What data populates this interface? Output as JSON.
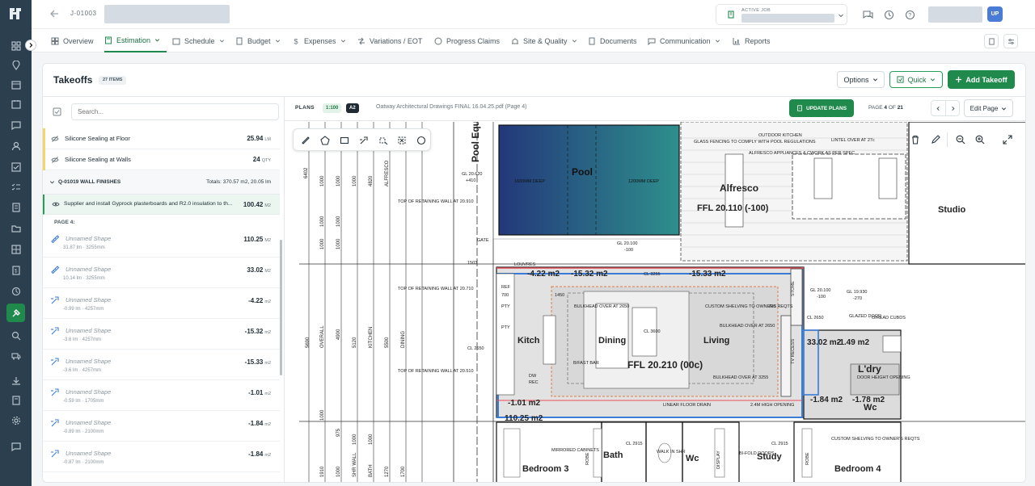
{
  "topbar": {
    "job_code": "J-01003",
    "active_job_label": "ACTIVE JOB",
    "user_initials": "UP"
  },
  "tabs": [
    {
      "label": "Overview",
      "icon": "grid-icon"
    },
    {
      "label": "Estimation",
      "icon": "calculator-icon"
    },
    {
      "label": "Schedule",
      "icon": "calendar-icon"
    },
    {
      "label": "Budget",
      "icon": "document-icon"
    },
    {
      "label": "Expenses",
      "icon": "dollar-icon"
    },
    {
      "label": "Variations / EOT",
      "icon": "variations-icon"
    },
    {
      "label": "Progress Claims",
      "icon": "claims-icon"
    },
    {
      "label": "Site & Quality",
      "icon": "site-icon"
    },
    {
      "label": "Documents",
      "icon": "document-icon"
    },
    {
      "label": "Communication",
      "icon": "chat-icon"
    },
    {
      "label": "Reports",
      "icon": "chart-icon"
    }
  ],
  "takeoffs": {
    "title": "Takeoffs",
    "count_badge": "27 ITEMS",
    "options_label": "Options",
    "quick_label": "Quick",
    "add_label": "Add Takeoff",
    "search_placeholder": "Search..."
  },
  "items_top": [
    {
      "name": "Silicone Sealing at Floor",
      "value": "25.94",
      "unit": "LM",
      "accent": "#f2d56b"
    },
    {
      "name": "Silicone Sealing at Walls",
      "value": "24",
      "unit": "QTY",
      "accent": "#f2d56b"
    }
  ],
  "group": {
    "code": "Q-01019 WALL FINISHES",
    "totals": "Totals: 370.57 m2, 20.05 lm"
  },
  "selected_item": {
    "name": "Supplier and install Gyprock plasterboards and R2.0 insulation to th...",
    "value": "100.42",
    "unit": "M2"
  },
  "page_label": "PAGE 4:",
  "shapes": [
    {
      "name": "Unnamed Shape",
      "sub": "31.87 lm · 3255mm",
      "value": "110.25",
      "unit": "M2",
      "icon": "ruler-icon"
    },
    {
      "name": "Unnamed Shape",
      "sub": "10.14 lm · 3255mm",
      "value": "33.02",
      "unit": "M2",
      "icon": "ruler-icon"
    },
    {
      "name": "Unnamed Shape",
      "sub": "-0.99 lm · 4257mm",
      "value": "-4.22",
      "unit": "m2",
      "icon": "deduct-icon"
    },
    {
      "name": "Unnamed Shape",
      "sub": "-3.6 lm · 4257mm",
      "value": "-15.32",
      "unit": "m2",
      "icon": "deduct-icon"
    },
    {
      "name": "Unnamed Shape",
      "sub": "-3.6 lm · 4257mm",
      "value": "-15.33",
      "unit": "m2",
      "icon": "deduct-icon"
    },
    {
      "name": "Unnamed Shape",
      "sub": "-0.59 lm · 1705mm",
      "value": "-1.01",
      "unit": "m2",
      "icon": "deduct-icon"
    },
    {
      "name": "Unnamed Shape",
      "sub": "-0.89 lm · 2100mm",
      "value": "-1.84",
      "unit": "m2",
      "icon": "deduct-icon"
    },
    {
      "name": "Unnamed Shape",
      "sub": "-0.87 lm · 2100mm",
      "value": "-1.84",
      "unit": "m2",
      "icon": "deduct-icon"
    }
  ],
  "plans": {
    "label": "PLANS",
    "scale": "1:100",
    "paper": "A2",
    "filename": "Oatway Architectural Drawings FINAL 16.04.25.pdf (Page 4)",
    "update_label": "UPDATE PLANS",
    "page_prefix": "PAGE",
    "page_current": "4",
    "page_of": "OF",
    "page_total": "21",
    "edit_page_label": "Edit Page"
  },
  "drawing": {
    "rooms": {
      "pool": "Pool",
      "pool_deep_left": "1600MM DEEP",
      "pool_deep_right": "1200MM DEEP",
      "alfresco": "Alfresco",
      "alfresco_ffl": "FFL 20.110 (-100)",
      "studio": "Studio",
      "kitchen": "Kitch",
      "dining": "Dining",
      "living": "Living",
      "main_ffl": "FFL 20.210 (00c)",
      "laundry": "L'dry",
      "wc": "Wc",
      "bedroom3": "Bedroom 3",
      "bath": "Bath",
      "wc2": "Wc",
      "study": "Study",
      "bedroom4": "Bedroom 4",
      "pool_equip": "Pool Equi"
    },
    "measures": {
      "m1": "-4.22 m2",
      "m2": "-15.32 m2",
      "m3": "-15.33 m2",
      "m4": "-1.01 m2",
      "m5": "110.25 m2",
      "m6": "33.02 m2",
      "m7": "-1.49 m2",
      "m8": "-1.84 m2",
      "m9": "-1.78 m2"
    },
    "notes": {
      "glass": "GLASS FENCING TO COMPLY WITH POOL REGULATIONS",
      "outdoor": "OUTDOOR KITCHEN",
      "alfresco_app": "ALFRESCO APPLIANCES & CWORK AS PER SPEC",
      "lintel": "LINTEL OVER AT 27c",
      "retaining1": "TOP OF RETAINING WALL AT 20.910",
      "retaining2": "TOP OF RETAINING WALL AT 20.710",
      "retaining3": "TOP OF RETAINING WALL AT 20.510",
      "gate": "GATE",
      "gl1": "GL 20.620",
      "gl1b": "+410",
      "gl2": "GL 20.100",
      "gl2b": "-100",
      "gl3": "GL 20.100",
      "gl3b": "-100",
      "gl4": "GL 19.930",
      "gl4b": "-270",
      "louvres": "LOUVRES",
      "cl3255": "CL 3255",
      "cl3600": "CL 3600",
      "cl2650": "CL 2650",
      "cl2650b": "CL 2650",
      "bulkhead1": "BULKHEAD OVER AT 2650",
      "bulkhead2": "BULKHEAD OVER AT 2650",
      "bulkhead3": "BULKHEAD OVER AT 3255",
      "custom1": "CUSTOM SHELVING TO OWNERS REQTS",
      "custom2": "CUSTOM SHELVING TO OWNER'S REQTS",
      "glazed": "GLAZED DOOR",
      "ohead": "O/HEAD CUBDS",
      "linear": "LINEAR FLOOR DRAIN",
      "high": "2.4M HIGH OPENING",
      "mirrored": "MIRRORED CABINETS",
      "walkin": "WALK IN SHR",
      "bifold": "BI-FOLD DOORS",
      "tv": "TV RECESS",
      "store": "STORE",
      "door_height": "DOOR HEIGHT OPENING",
      "cl2915a": "CL 2915",
      "cl2915b": "CL 2915",
      "n1450": "1450",
      "n700a": "700",
      "n700b": "700",
      "n1503": "1503",
      "ref": "REF",
      "pty1": "PTY",
      "pty2": "PTY",
      "dw": "DW",
      "rec": "REC",
      "bfast": "B/FAST BAR",
      "robe1": "ROBE",
      "robe2": "ROBE",
      "display": "DISPLAY"
    }
  }
}
